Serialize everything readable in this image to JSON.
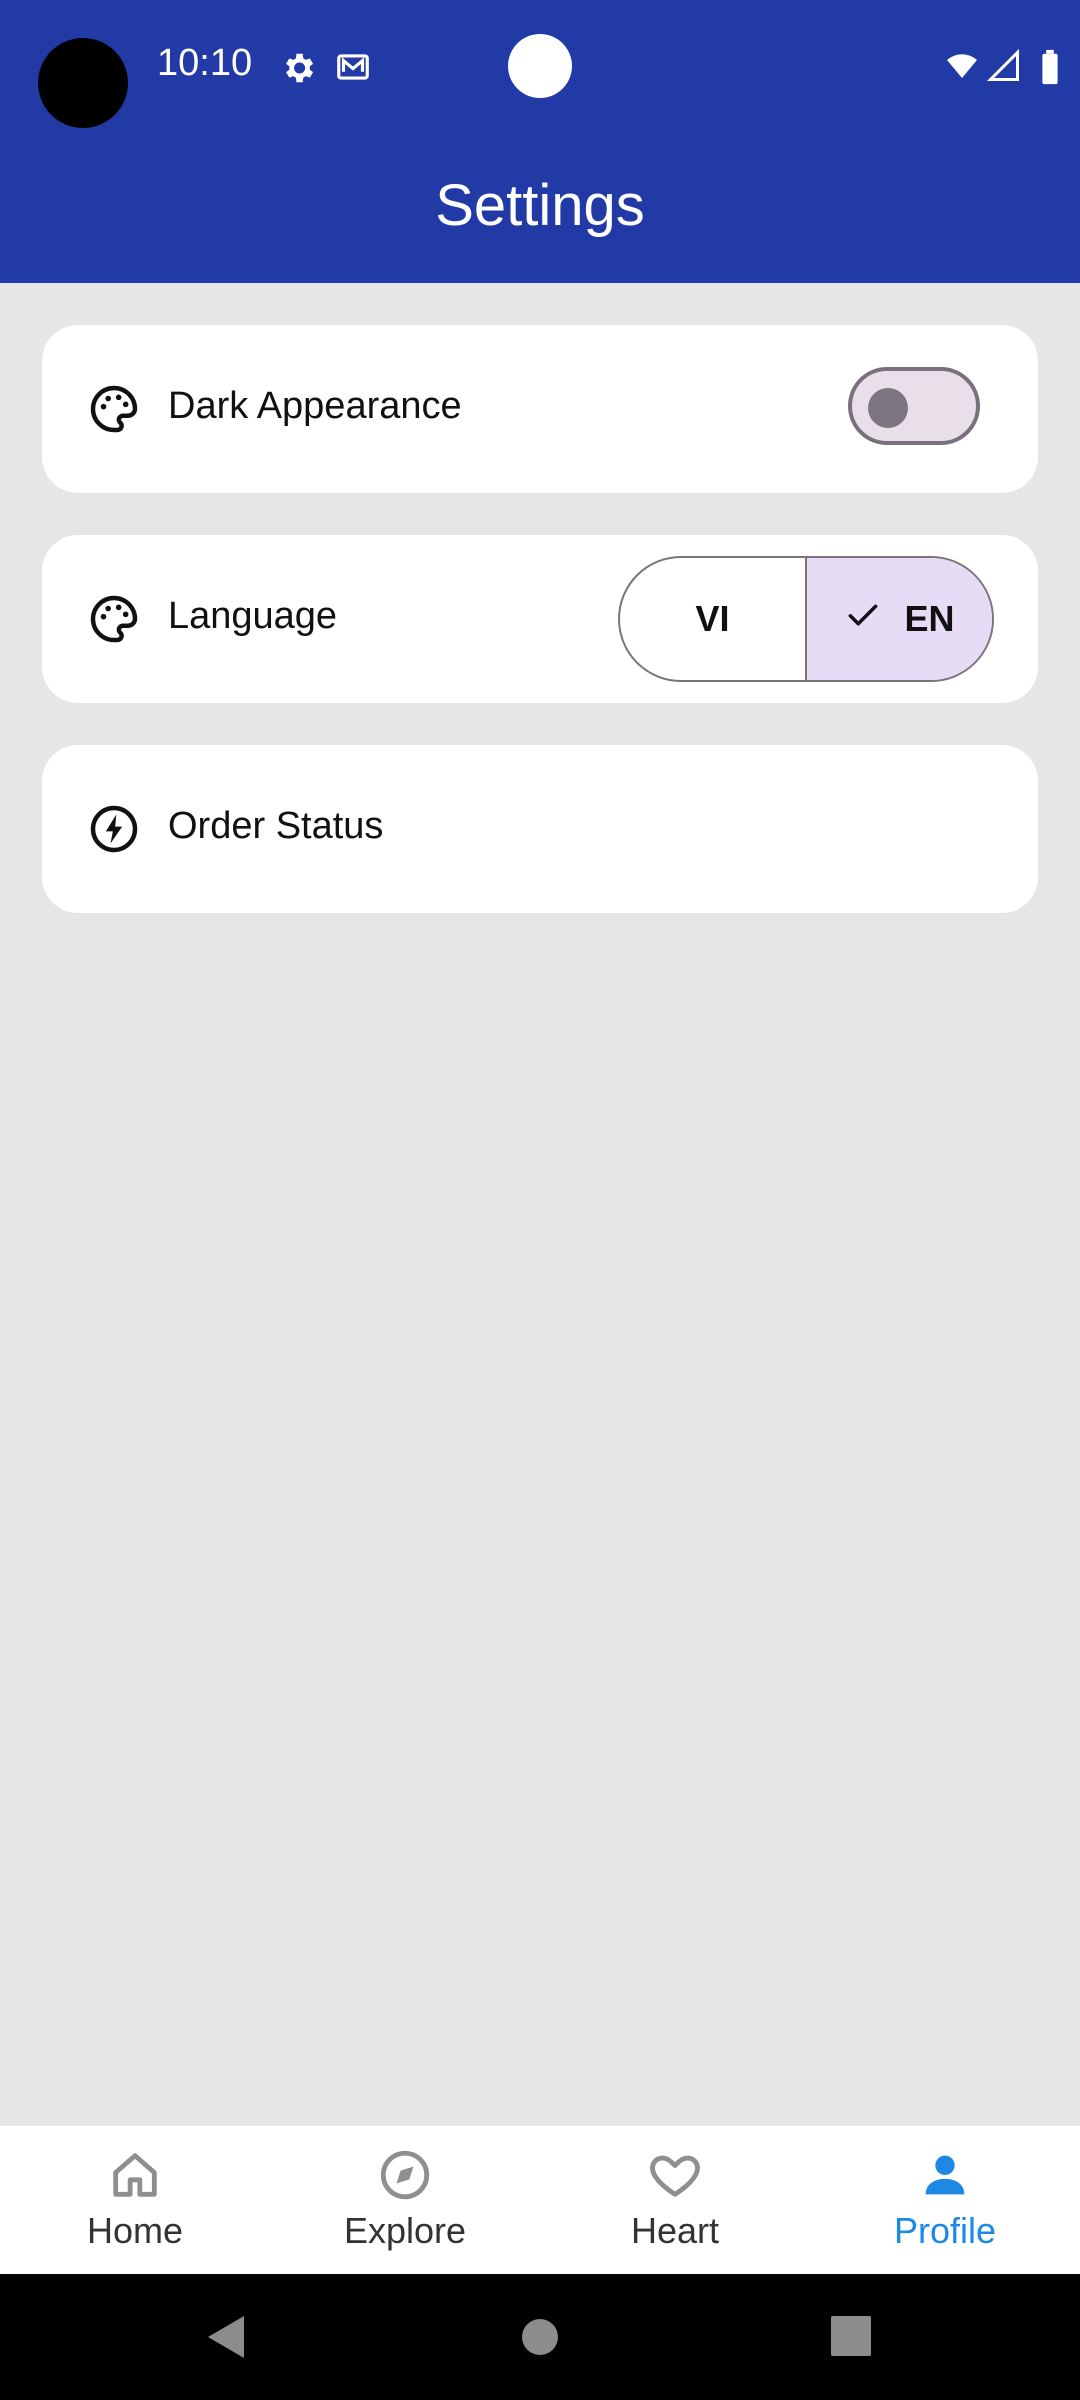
{
  "status_bar": {
    "time": "10:10",
    "icons": [
      "camera-cutout",
      "settings-gear-icon",
      "mail-icon",
      "front-camera-dot",
      "wifi-icon",
      "cell-signal-icon",
      "battery-icon"
    ]
  },
  "app_bar": {
    "title": "Settings"
  },
  "settings": {
    "dark_appearance": {
      "label": "Dark Appearance",
      "icon": "palette-icon",
      "enabled": false
    },
    "language": {
      "label": "Language",
      "icon": "palette-icon",
      "options": [
        "VI",
        "EN"
      ],
      "selected": "EN"
    },
    "order_status": {
      "label": "Order Status",
      "icon": "bolt-icon"
    }
  },
  "bottom_nav": {
    "items": [
      {
        "label": "Home",
        "icon": "home-icon",
        "active": false
      },
      {
        "label": "Explore",
        "icon": "compass-icon",
        "active": false
      },
      {
        "label": "Heart",
        "icon": "heart-icon",
        "active": false
      },
      {
        "label": "Profile",
        "icon": "person-icon",
        "active": true
      }
    ],
    "active_color": "#1e88e5",
    "inactive_color": "#8f8f8f"
  },
  "system_nav": {
    "icons": [
      "back-triangle-icon",
      "home-circle-icon",
      "recent-square-icon"
    ]
  },
  "colors": {
    "app_bar": "#223aa6",
    "background": "#e6e6e6",
    "card": "#ffffff",
    "segment_selected": "#e7dcf6"
  }
}
